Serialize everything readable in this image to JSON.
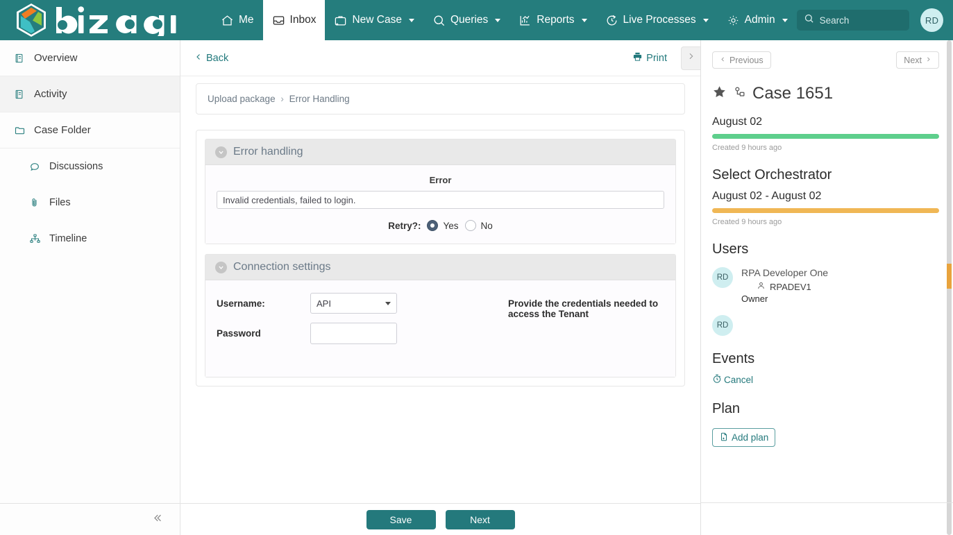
{
  "topnav": {
    "brand": "bizagi",
    "items": [
      {
        "label": "Me",
        "icon": "home-icon",
        "caret": false,
        "active": false
      },
      {
        "label": "Inbox",
        "icon": "inbox-icon",
        "caret": false,
        "active": true
      },
      {
        "label": "New Case",
        "icon": "new-case-icon",
        "caret": true,
        "active": false
      },
      {
        "label": "Queries",
        "icon": "search-icon",
        "caret": true,
        "active": false
      },
      {
        "label": "Reports",
        "icon": "reports-chart-icon",
        "caret": true,
        "active": false
      },
      {
        "label": "Live Processes",
        "icon": "live-processes-icon",
        "caret": true,
        "active": false
      },
      {
        "label": "Admin",
        "icon": "gear-icon",
        "caret": true,
        "active": false
      }
    ],
    "search_placeholder": "Search",
    "search_value": "",
    "avatar_initials": "RD"
  },
  "sidebar": {
    "items": [
      {
        "label": "Overview",
        "icon": "document-icon",
        "selected": false,
        "sub": false
      },
      {
        "label": "Activity",
        "icon": "document-icon",
        "selected": true,
        "sub": false
      },
      {
        "label": "Case Folder",
        "icon": "folder-icon",
        "selected": false,
        "sub": false
      },
      {
        "label": "Discussions",
        "icon": "comment-icon",
        "selected": false,
        "sub": true
      },
      {
        "label": "Files",
        "icon": "paperclip-icon",
        "selected": false,
        "sub": true
      },
      {
        "label": "Timeline",
        "icon": "sitemap-icon",
        "selected": false,
        "sub": true
      }
    ],
    "collapse_icon": "double-chevron-left-icon"
  },
  "toolbar": {
    "back_label": "Back",
    "print_label": "Print",
    "collapse_icon": "chevron-right-icon"
  },
  "breadcrumb": {
    "root": "Upload package",
    "separator": "›",
    "current": "Error Handling"
  },
  "form": {
    "sections": [
      {
        "title": "Error handling",
        "error_label": "Error",
        "error_value": "Invalid credentials, failed to login.",
        "retry_label": "Retry?:",
        "retry_yes": "Yes",
        "retry_no": "No",
        "retry_selected": "Yes"
      },
      {
        "title": "Connection settings",
        "username_label": "Username:",
        "username_value": "API",
        "password_label": "Password",
        "password_value": "",
        "help_text": "Provide the credentials needed to access the Tenant"
      }
    ]
  },
  "footer": {
    "save_label": "Save",
    "next_label": "Next"
  },
  "rightpanel": {
    "previous_label": "Previous",
    "next_label": "Next",
    "case_title": "Case 1651",
    "star_icon": "star-icon",
    "process_icon": "process-node-icon",
    "activity": {
      "date": "August 02",
      "bar_color": "#5ecf8c",
      "meta": "Created 9 hours ago"
    },
    "stage": {
      "heading": "Select Orchestrator",
      "date_range": "August 02 - August 02",
      "bar_color": "#f0b755",
      "meta": "Created 9 hours ago"
    },
    "users_heading": "Users",
    "users": [
      {
        "initials": "RD",
        "name": "RPA Developer One",
        "login": "RPADEV1",
        "role": "Owner"
      },
      {
        "initials": "RD",
        "name": "",
        "login": "",
        "role": ""
      }
    ],
    "events_heading": "Events",
    "events": [
      {
        "label": "Cancel",
        "icon": "timer-icon"
      }
    ],
    "plan_heading": "Plan",
    "add_plan_label": "Add plan",
    "add_plan_icon": "document-plus-icon"
  },
  "colors": {
    "brand_teal": "#257d7d",
    "accent_link": "#24797c",
    "progress_green": "#5ecf8c",
    "progress_orange": "#f0b755",
    "avatar_bg": "#cfeef0"
  }
}
